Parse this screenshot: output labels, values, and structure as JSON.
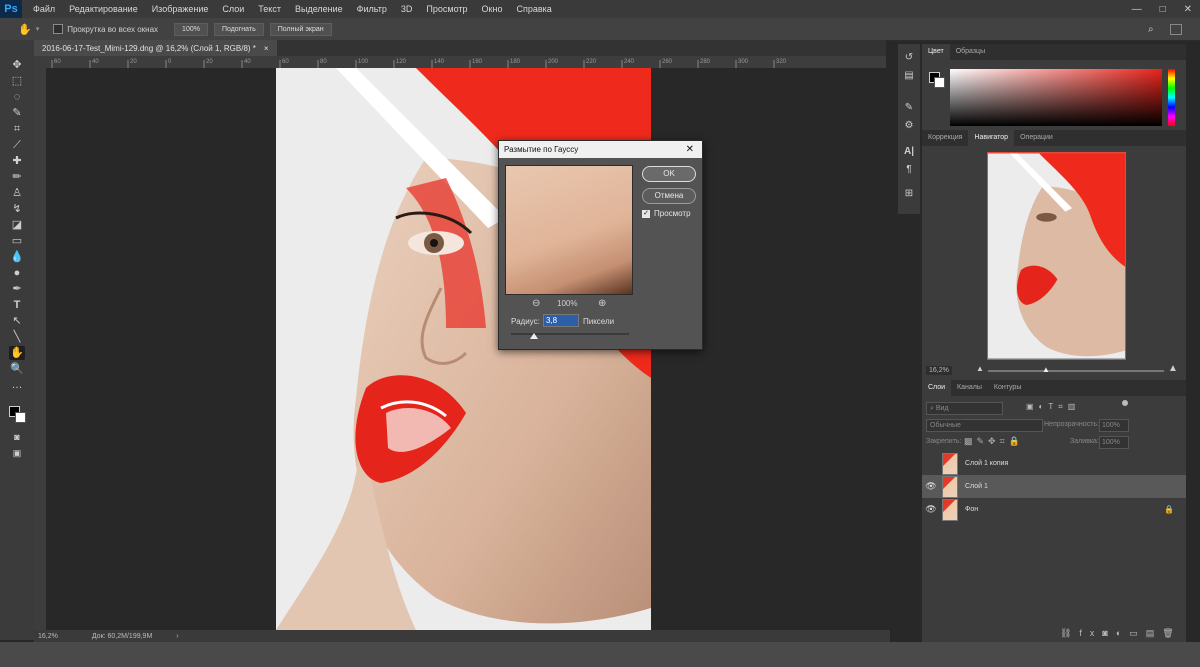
{
  "app": {
    "logo": "Ps"
  },
  "menu": [
    "Файл",
    "Редактирование",
    "Изображение",
    "Слои",
    "Текст",
    "Выделение",
    "Фильтр",
    "3D",
    "Просмотр",
    "Окно",
    "Справка"
  ],
  "window_controls": {
    "minimize": "—",
    "maximize": "□",
    "close": "✕"
  },
  "options_bar": {
    "scroll_all": "Прокрутка во всех окнах",
    "zoom_100": "100%",
    "fit": "Подогнать",
    "fullscreen": "Полный экран"
  },
  "document_tab": {
    "title": "2016-06-17-Test_Mimi-129.dng @ 16,2% (Слой 1, RGB/8) *",
    "close": "×"
  },
  "ruler_ticks": [
    "60",
    "40",
    "20",
    "0",
    "20",
    "40",
    "60",
    "80",
    "100",
    "120",
    "140",
    "160",
    "180",
    "200",
    "220",
    "240",
    "260",
    "280",
    "300",
    "320"
  ],
  "status": {
    "zoom": "16,2%",
    "doc": "Док: 60,2M/199,9M"
  },
  "dialog": {
    "title": "Размытие по Гауссу",
    "close": "✕",
    "ok": "OK",
    "cancel": "Отмена",
    "preview": "Просмотр",
    "zoom": "100%",
    "radius_label": "Радиус:",
    "radius_value": "3,8",
    "radius_unit": "Пиксели"
  },
  "color_panel": {
    "tabs": [
      "Цвет",
      "Образцы"
    ],
    "active": "Цвет",
    "accent": "#e8231a"
  },
  "navigator_panel": {
    "tabs": [
      "Коррекция",
      "Навигатор",
      "Операции"
    ],
    "active": "Навигатор",
    "zoom": "16,2%"
  },
  "layers_panel": {
    "tabs": [
      "Слои",
      "Каналы",
      "Контуры"
    ],
    "active": "Слои",
    "search_placeholder": "Вид",
    "blend_mode": "Обычные",
    "opacity_label": "Непрозрачность:",
    "opacity_value": "100%",
    "lock_label": "Закрепить:",
    "fill_label": "Заливка:",
    "fill_value": "100%",
    "layers": [
      {
        "name": "Слой 1 копия",
        "visible": false,
        "selected": false,
        "locked": false
      },
      {
        "name": "Слой 1",
        "visible": true,
        "selected": true,
        "locked": false
      },
      {
        "name": "Фон",
        "visible": true,
        "selected": false,
        "locked": true
      }
    ]
  }
}
